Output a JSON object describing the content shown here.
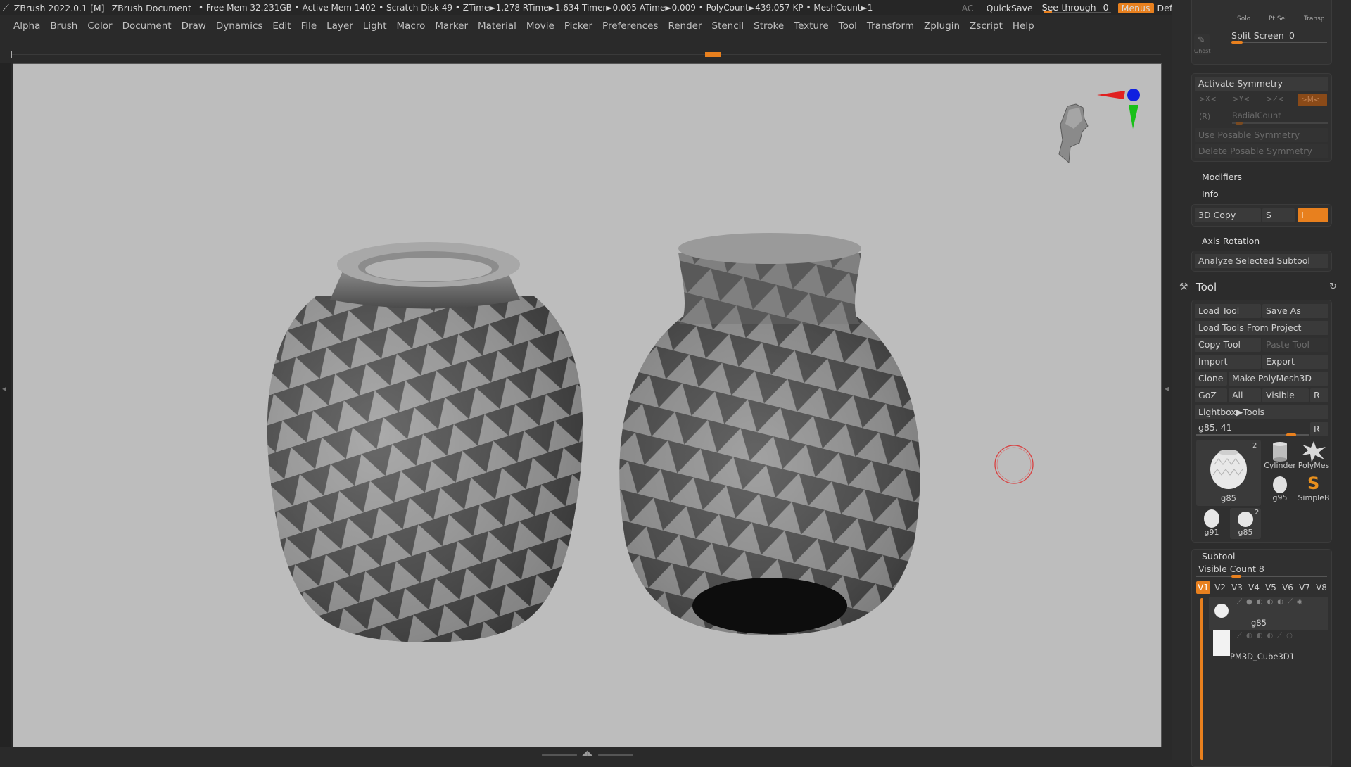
{
  "titlebar": {
    "app": "ZBrush 2022.0.1 [M]",
    "document": "ZBrush Document",
    "stats": "• Free Mem 32.231GB • Active Mem 1402 • Scratch Disk 49 •  ZTime►1.278 RTime►1.634 Timer►0.005 ATime►0.009 • PolyCount►439.057 KP  • MeshCount►1",
    "ac": "AC",
    "quicksave": "QuickSave",
    "see_through_label": "See-through",
    "see_through_value": "0",
    "menus": "Menus",
    "default_zscript": "DefaultZScript"
  },
  "menubar": [
    "Alpha",
    "Brush",
    "Color",
    "Document",
    "Draw",
    "Dynamics",
    "Edit",
    "File",
    "Layer",
    "Light",
    "Macro",
    "Marker",
    "Material",
    "Movie",
    "Picker",
    "Preferences",
    "Render",
    "Stencil",
    "Stroke",
    "Texture",
    "Tool",
    "Transform",
    "Zplugin",
    "Zscript",
    "Help"
  ],
  "panel": {
    "top": {
      "solo": "Solo",
      "pt_sel": "Pt Sel",
      "transp": "Transp",
      "ghost": "Ghost",
      "split_screen": "Split Screen",
      "split_screen_value": "0"
    },
    "symmetry": {
      "activate": "Activate Symmetry",
      "x": ">X<",
      "y": ">Y<",
      "z": ">Z<",
      "m": ">M<",
      "r": "(R)",
      "radial_count": "RadialCount",
      "use_posable": "Use Posable Symmetry",
      "delete_posable": "Delete Posable Symmetry"
    },
    "modifiers": "Modifiers",
    "info": "Info",
    "copy3d": "3D Copy",
    "s": "S",
    "i": "I",
    "axis_rotation": "Axis Rotation",
    "analyze": "Analyze Selected Subtool",
    "tool": {
      "title": "Tool",
      "load_tool": "Load Tool",
      "save_as": "Save As",
      "load_from_project": "Load Tools From Project",
      "copy_tool": "Copy Tool",
      "paste_tool": "Paste Tool",
      "import": "Import",
      "export": "Export",
      "clone": "Clone",
      "make_polymesh": "Make PolyMesh3D",
      "goz": "GoZ",
      "all": "All",
      "visible": "Visible",
      "r": "R",
      "lightbox": "Lightbox▶Tools",
      "current": "g85. 41",
      "current_r": "R",
      "thumbs": [
        {
          "label": "g85",
          "count": "2"
        },
        {
          "label": "Cylinder"
        },
        {
          "label": "PolyMes"
        },
        {
          "label": "g95"
        },
        {
          "label": "SimpleB"
        },
        {
          "label": "g91"
        },
        {
          "label": "g85",
          "count": "2"
        }
      ]
    },
    "subtool": {
      "title": "Subtool",
      "visible_count": "Visible Count 8",
      "views": [
        "V1",
        "V2",
        "V3",
        "V4",
        "V5",
        "V6",
        "V7",
        "V8"
      ],
      "items": [
        "g85",
        "PM3D_Cube3D1"
      ]
    }
  },
  "colors": {
    "accent": "#e8801e",
    "viewport_bg": "#bdbdbd",
    "panel_bg": "#2c2c2c"
  }
}
